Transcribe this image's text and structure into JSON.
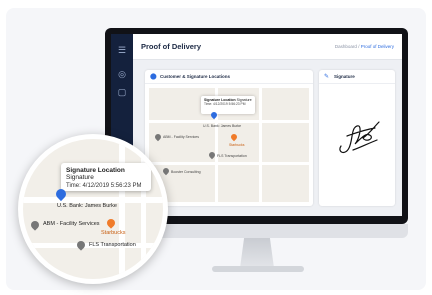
{
  "app": {
    "page_title": "Proof of Delivery",
    "breadcrumb": {
      "root": "Dashboard",
      "separator": "/",
      "current": "Proof of Delivery"
    }
  },
  "panels": {
    "locations": {
      "title": "Customer & Signature Locations"
    },
    "signature": {
      "title": "Signature"
    }
  },
  "map": {
    "popup": {
      "title_bold": "Signature Location",
      "title_rest": " Signature",
      "time": "Time: 4/12/2019 5:56:23 PM"
    },
    "pois": {
      "customer": "U.S. Bank: James Burke",
      "facility": "ABM - Facility Services",
      "starbucks": "Starbucks",
      "fls": "FLS Transportation",
      "booster": "Booster Consulting"
    }
  },
  "colors": {
    "accent": "#2d6cdf",
    "sidebar": "#14213d",
    "starbucks": "#f07b2a"
  }
}
